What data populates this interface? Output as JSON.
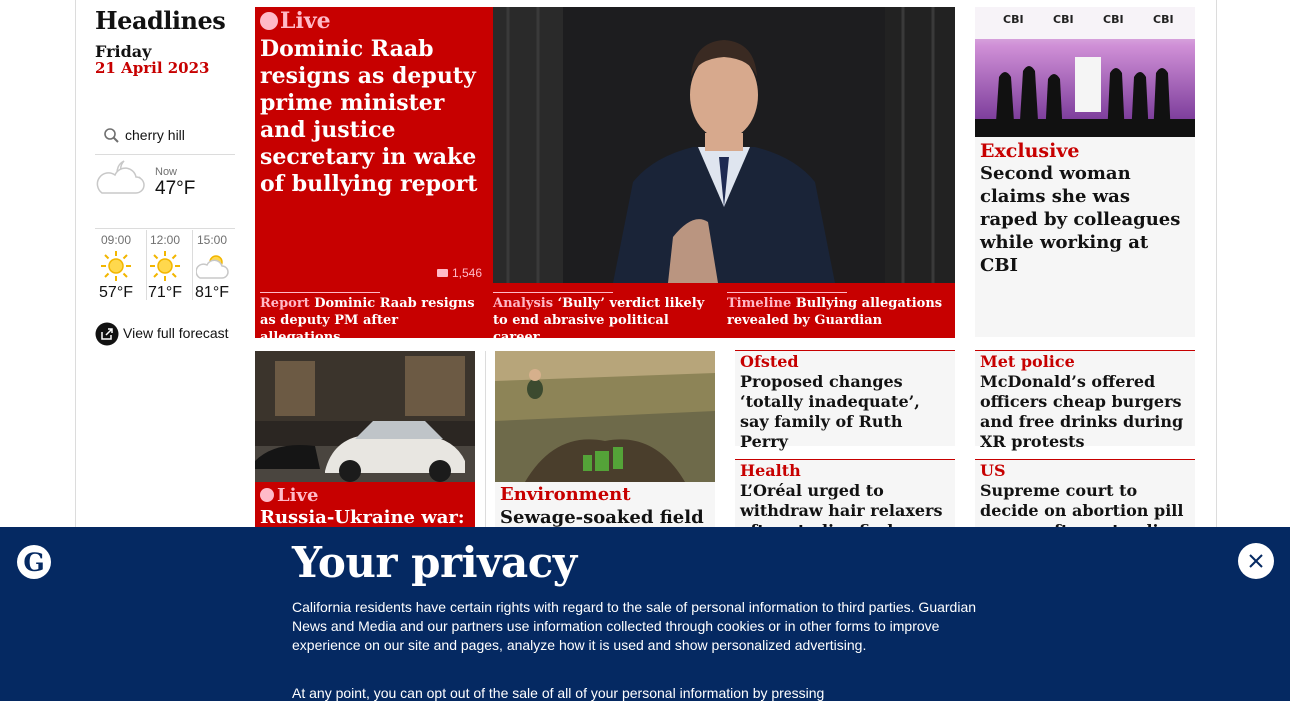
{
  "headlines": {
    "title": "Headlines",
    "day": "Friday",
    "date": "21 April 2023"
  },
  "weather": {
    "location": "cherry hill",
    "now_label": "Now",
    "now_temp": "47°F",
    "forecast": [
      {
        "time": "09:00",
        "temp": "57°F",
        "icon": "sun-icon"
      },
      {
        "time": "12:00",
        "temp": "71°F",
        "icon": "sun-icon"
      },
      {
        "time": "15:00",
        "temp": "81°F",
        "icon": "partly-cloudy-icon"
      }
    ],
    "full_forecast_label": "View full forecast"
  },
  "lead": {
    "live_label": "Live",
    "headline": "Dominic Raab resigns as deputy prime minister and justice secretary in wake of bullying report",
    "comments": "1,546",
    "sublinks": [
      {
        "kicker": "Report",
        "text": "Dominic Raab resigns as deputy PM after allegations"
      },
      {
        "kicker": "Analysis",
        "text": "‘Bully’ verdict likely to end abrasive political career"
      },
      {
        "kicker": "Timeline",
        "text": "Bullying allegations revealed by Guardian"
      }
    ]
  },
  "right_top": {
    "kicker": "Exclusive",
    "headline": "Second woman claims she was raped by colleagues while working at CBI",
    "photo_text": "CBI"
  },
  "row2": {
    "ukraine": {
      "live_label": "Live",
      "headline": "Russia-Ukraine war:"
    },
    "environment": {
      "kicker": "Environment",
      "headline": "Sewage-soaked field"
    },
    "ofsted": {
      "kicker": "Ofsted",
      "headline": "Proposed changes ‘totally inadequate’, say family of Ruth Perry"
    },
    "metpolice": {
      "kicker": "Met police",
      "headline": "McDonald’s offered officers cheap burgers and free drinks during XR protests"
    },
    "health": {
      "kicker": "Health",
      "headline": "L’Oréal urged to withdraw hair relaxers after studies find cancer risk"
    },
    "us": {
      "kicker": "US",
      "headline": "Supreme court to decide on abortion pill access after extending deadline"
    }
  },
  "privacy": {
    "title": "Your privacy",
    "text": "California residents have certain rights with regard to the sale of personal information to third parties. Guardian News and Media and our partners use information collected through cookies or in other forms to improve experience on our site and pages, analyze how it is used and show personalized advertising.",
    "text2": "At any point, you can opt out of the sale of all of your personal information by pressing"
  },
  "colors": {
    "red": "#c70000",
    "pink": "#ffbac8",
    "navy": "#052962"
  }
}
